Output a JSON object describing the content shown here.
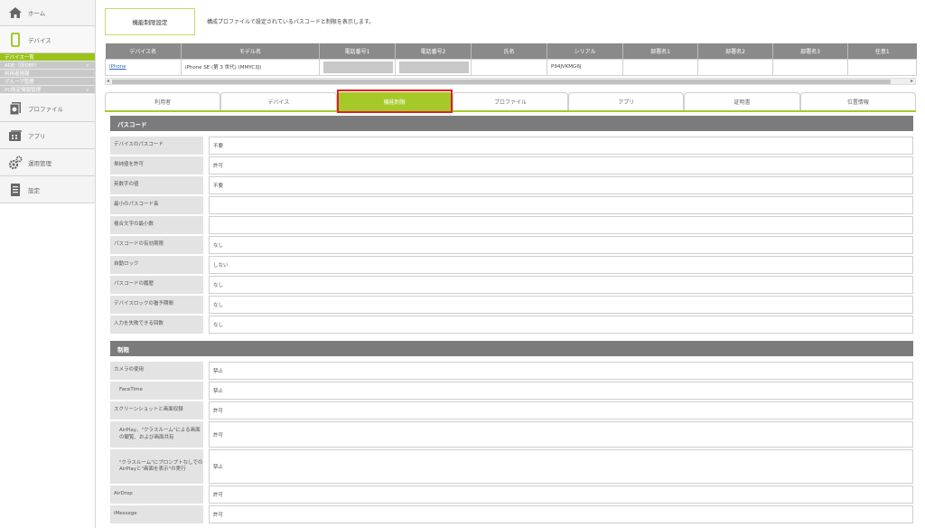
{
  "sidebar": {
    "home": "ホーム",
    "device": "デバイス",
    "subs": [
      {
        "label": "デバイス一覧",
        "chev": ""
      },
      {
        "label": "ADE（旧DEP）",
        "chev": "∨"
      },
      {
        "label": "利用者情報",
        "chev": ""
      },
      {
        "label": "グループ管理",
        "chev": ""
      },
      {
        "label": "PC既定情報管理",
        "chev": "∨"
      }
    ],
    "profile": "プロファイル",
    "app": "アプリ",
    "ops": "運用管理",
    "settings": "設定"
  },
  "header": {
    "title": "機能制限設定",
    "description": "構成プロファイルで設定されているパスコードと制限を表示します。"
  },
  "device_table": {
    "headers": [
      "デバイス名",
      "モデル名",
      "電話番号1",
      "電話番号2",
      "氏名",
      "シリアル",
      "部署名1",
      "部署名2",
      "部署名3",
      "任意1"
    ],
    "row": {
      "device_name": "iPhone",
      "model": "iPhone SE (第 3 世代) (MMYC3J)",
      "phone1": "",
      "phone2": "",
      "name": "",
      "serial": "P94JVKMG6J",
      "dept1": "",
      "dept2": "",
      "dept3": "",
      "opt1": ""
    },
    "scroll_left": "◂",
    "scroll_right": "▸"
  },
  "tabs": [
    "利用者",
    "デバイス",
    "機能制限",
    "プロファイル",
    "アプリ",
    "証明書",
    "位置情報"
  ],
  "passcode": {
    "title": "パスコード",
    "rows": [
      {
        "label": "デバイスのパスコード",
        "value": "不要"
      },
      {
        "label": "単純値を許可",
        "value": "許可"
      },
      {
        "label": "英数字の値",
        "value": "不要"
      },
      {
        "label": "最小のパスコード長",
        "value": ""
      },
      {
        "label": "複合文字の最小数",
        "value": ""
      },
      {
        "label": "パスコードの有効期限",
        "value": "なし"
      },
      {
        "label": "自動ロック",
        "value": "しない"
      },
      {
        "label": "パスコードの履歴",
        "value": "なし"
      },
      {
        "label": "デバイスロックの猶予期間",
        "value": "なし"
      },
      {
        "label": "入力を失敗できる回数",
        "value": "なし"
      }
    ]
  },
  "restrictions": {
    "title": "制限",
    "rows": [
      {
        "label": "カメラの使用",
        "value": "禁止"
      },
      {
        "label": "FaceTime",
        "value": "禁止"
      },
      {
        "label": "スクリーンショットと画面収録",
        "value": "許可"
      },
      {
        "label": "AirPlay、\"クラスルーム\"による画面の観覧、および画面共有",
        "value": "許可"
      },
      {
        "label": "\"クラスルーム\"にプロンプトなしでのAirPlayと\"画面を表示\"の実行",
        "value": "禁止"
      },
      {
        "label": "AirDrop",
        "value": "許可"
      },
      {
        "label": "iMessage",
        "value": "許可"
      }
    ]
  },
  "colors": {
    "accent": "#a6c92a",
    "highlight": "#e02020",
    "section": "#7b7b7b"
  }
}
